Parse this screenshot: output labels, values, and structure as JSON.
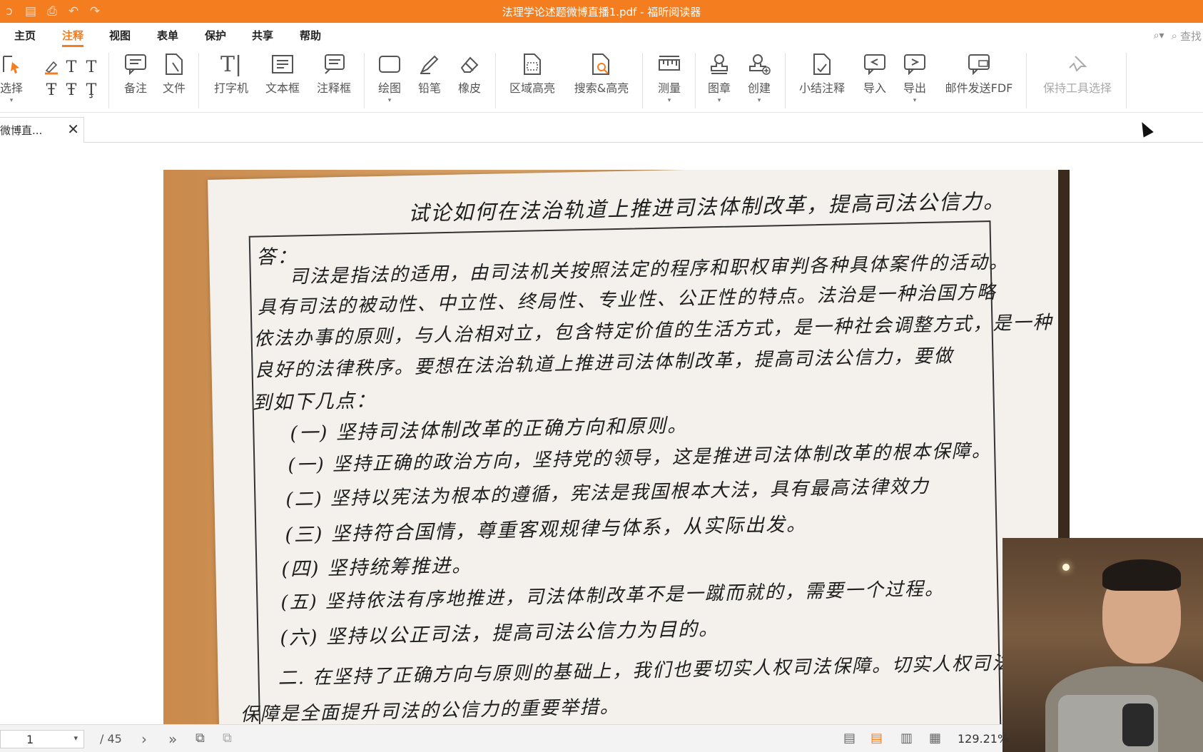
{
  "window": {
    "title": "法理学论述题微博直播1.pdf - 福昕阅读器",
    "quick_access_icons": [
      "app-icon",
      "save-icon",
      "print-icon",
      "undo-icon",
      "redo-icon"
    ]
  },
  "menu": {
    "items": [
      "主页",
      "注释",
      "视图",
      "表单",
      "保护",
      "共享",
      "帮助"
    ],
    "active": "注释",
    "search_placeholder": "查找"
  },
  "toolbar": {
    "select_label": "选择",
    "note_label": "备注",
    "file_label": "文件",
    "typewriter_label": "打字机",
    "textbox_label": "文本框",
    "callout_label": "注释框",
    "draw_label": "绘图",
    "pencil_label": "铅笔",
    "eraser_label": "橡皮",
    "area_highlight_label": "区域高亮",
    "search_highlight_label": "搜索&高亮",
    "measure_label": "测量",
    "stamp_label": "图章",
    "create_label": "创建",
    "summarize_label": "小结注释",
    "import_label": "导入",
    "export_label": "导出",
    "email_fdf_label": "邮件发送FDF",
    "keep_tool_label": "保持工具选择"
  },
  "tab": {
    "title": "微博直...",
    "close": "✕"
  },
  "document": {
    "handwritten_lines": [
      "试论如何在法治轨道上推进司法体制改革，提高司法公信力。",
      "答：",
      "司法是指法的适用，由司法机关按照法定的程序和职权审判各种具体案件的活动。",
      "具有司法的被动性、中立性、终局性、专业性、公正性的特点。法治是一种治国方略",
      "依法办事的原则，与人治相对立，包含特定价值的生活方式，是一种社会调整方式，是一种",
      "良好的法律秩序。要想在法治轨道上推进司法体制改革，提高司法公信力，要做",
      "到如下几点：",
      "(一) 坚持司法体制改革的正确方向和原则。",
      "(一) 坚持正确的政治方向，坚持党的领导，这是推进司法体制改革的根本保障。",
      "(二) 坚持以宪法为根本的遵循，宪法是我国根本大法，具有最高法律效力",
      "(三) 坚持符合国情，尊重客观规律与体系，从实际出发。",
      "(四) 坚持统筹推进。",
      "(五) 坚持依法有序地推进，司法体制改革不是一蹴而就的，需要一个过程。",
      "(六) 坚持以公正司法，提高司法公信力为目的。",
      "二. 在坚持了正确方向与原则的基础上，我们也要切实人权司法保障。切实人权司法",
      "保障是全面提升司法的公信力的重要举措。"
    ]
  },
  "status": {
    "current_page": "1",
    "total_pages": "/ 45",
    "zoom": "129.21%"
  },
  "colors": {
    "accent": "#f47d20"
  }
}
